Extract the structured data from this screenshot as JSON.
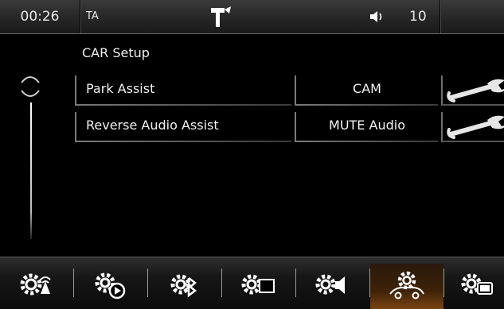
{
  "status_bar": {
    "clock": "00:26",
    "traffic_announcement": "TA",
    "nav_icon": "turn-right-arrow-icon",
    "volume_icon": "speaker-icon",
    "volume_value": "10"
  },
  "main": {
    "title": "CAR Setup",
    "rows": [
      {
        "label": "Park Assist",
        "value": "CAM",
        "tool_icon": "wrench-icon"
      },
      {
        "label": "Reverse Audio Assist",
        "value": "MUTE Audio",
        "tool_icon": "wrench-icon"
      }
    ]
  },
  "bottom_tabs": [
    {
      "icon": "gear-antenna-icon"
    },
    {
      "icon": "gear-play-icon"
    },
    {
      "icon": "gear-bluetooth-icon"
    },
    {
      "icon": "gear-display-icon"
    },
    {
      "icon": "gear-speaker-icon"
    },
    {
      "icon": "gear-car-icon",
      "active": true
    },
    {
      "icon": "gear-screen-icon"
    }
  ],
  "colors": {
    "active_tab": "#7a4412",
    "background": "#000000"
  }
}
